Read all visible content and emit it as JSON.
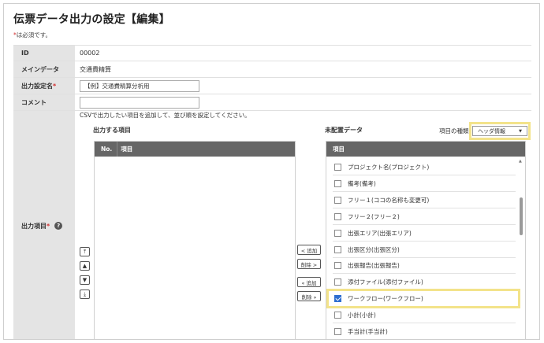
{
  "page": {
    "title": "伝票データ出力の設定【編集】",
    "required_star": "*",
    "required_note": "は必須です。"
  },
  "form": {
    "id_label": "ID",
    "id_value": "00002",
    "main_data_label": "メインデータ",
    "main_data_value": "交通費精算",
    "output_name_label": "出力設定名",
    "output_name_value": "【例】交通費精算分析用",
    "comment_label": "コメント",
    "comment_value": "",
    "output_items_label": "出力項目",
    "required_star": "*",
    "instruction": "CSVで出力したい項目を追加して、並び順を設定してください。"
  },
  "output_panel": {
    "heading": "出力する項目",
    "col_no": "No.",
    "col_item": "項目"
  },
  "unassigned_panel": {
    "heading": "未配置データ",
    "item_type_label": "項目の種類",
    "item_type_value": "ヘッダ情報",
    "col_item": "項目",
    "items": [
      {
        "label": "プロジェクト名(プロジェクト)",
        "checked": false
      },
      {
        "label": "備考(備考)",
        "checked": false
      },
      {
        "label": "フリー１(ココの名称も変更可)",
        "checked": false
      },
      {
        "label": "フリー２(フリー２)",
        "checked": false
      },
      {
        "label": "出張エリア(出張エリア)",
        "checked": false
      },
      {
        "label": "出張区分(出張区分)",
        "checked": false
      },
      {
        "label": "出張報告(出張報告)",
        "checked": false
      },
      {
        "label": "添付ファイル(添付ファイル)",
        "checked": false
      },
      {
        "label": "ワークフロー(ワークフロー)",
        "checked": true
      },
      {
        "label": "小計(小計)",
        "checked": false
      },
      {
        "label": "手当計(手当計)",
        "checked": false
      }
    ]
  },
  "move_buttons": {
    "add": "< 追加",
    "remove": "削除 >",
    "add_all": "« 追加",
    "remove_all": "削除 »"
  },
  "order_buttons": {
    "top": "⤒",
    "up": "▲",
    "down": "▼",
    "bottom": "⤓"
  },
  "colors": {
    "label_bg": "#e4e4e4",
    "header_bg": "#666666",
    "highlight": "#f3e38a",
    "checkbox_checked": "#2f6fd0",
    "required": "#d32f2f"
  }
}
